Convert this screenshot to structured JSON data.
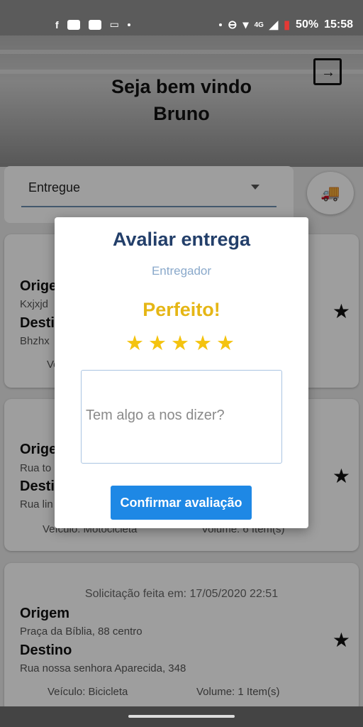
{
  "status_bar": {
    "battery": "50%",
    "time": "15:58",
    "network": "4G"
  },
  "header": {
    "greeting": "Seja bem vindo",
    "user_name": "Bruno"
  },
  "filter": {
    "selected": "Entregue"
  },
  "cards": [
    {
      "origin_label": "Orige",
      "origin_value": "Kxjxjd",
      "dest_label": "Destin",
      "dest_value": "Bhzhx",
      "vehicle_partial": "Ve"
    },
    {
      "origin_label": "Orige",
      "origin_value": "Rua to",
      "dest_label": "Desti",
      "dest_value": "Rua lin",
      "vehicle": "Veículo: Motocicleta",
      "volume": "Volume: 6 Item(s)"
    },
    {
      "date": "Solicitação feita em: 17/05/2020 22:51",
      "origin_label": "Origem",
      "origin_value": "Praça da Bíblia, 88 centro",
      "dest_label": "Destino",
      "dest_value": "Rua nossa senhora Aparecida, 348",
      "vehicle": "Veículo: Bicicleta",
      "volume": "Volume: 1 Item(s)"
    }
  ],
  "dialog": {
    "title": "Avaliar entrega",
    "subtitle": "Entregador",
    "rating_text": "Perfeito!",
    "rating": 5,
    "comment_placeholder": "Tem algo a nos dizer?",
    "confirm_label": "Confirmar avaliação"
  },
  "colors": {
    "title": "#233f6a",
    "rating": "#e5b615",
    "star": "#f4c30f",
    "button": "#1e88e5"
  }
}
